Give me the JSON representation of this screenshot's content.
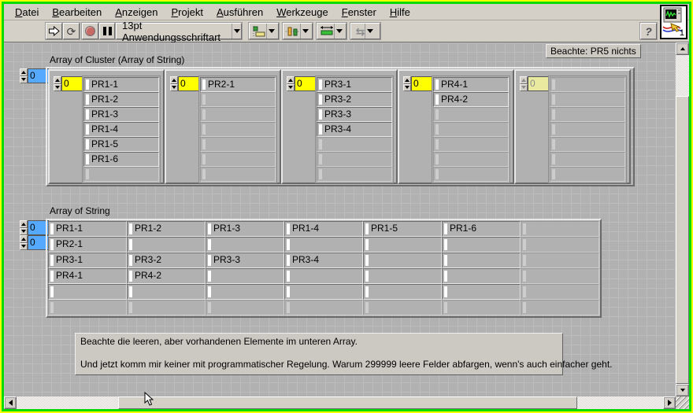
{
  "window": {
    "panel_badge": "1"
  },
  "menu": {
    "items": [
      "Datei",
      "Bearbeiten",
      "Anzeigen",
      "Projekt",
      "Ausführen",
      "Werkzeuge",
      "Fenster",
      "Hilfe"
    ]
  },
  "toolbar": {
    "font_selector": "13pt Anwendungsschriftart",
    "help_label": "?"
  },
  "panel": {
    "note": "Beachte: PR5 nichts",
    "cluster_array": {
      "label": "Array of Cluster (Array of String)",
      "index": "0",
      "visible_rows": 7,
      "clusters": [
        {
          "index": "0",
          "dimmed": false,
          "items": [
            "PR1-1",
            "PR1-2",
            "PR1-3",
            "PR1-4",
            "PR1-5",
            "PR1-6"
          ]
        },
        {
          "index": "0",
          "dimmed": false,
          "items": [
            "PR2-1"
          ]
        },
        {
          "index": "0",
          "dimmed": false,
          "items": [
            "PR3-1",
            "PR3-2",
            "PR3-3",
            "PR3-4"
          ]
        },
        {
          "index": "0",
          "dimmed": false,
          "items": [
            "PR4-1",
            "PR4-2"
          ]
        },
        {
          "index": "0",
          "dimmed": true,
          "items": []
        }
      ]
    },
    "string_array": {
      "label": "Array of String",
      "row_index": "0",
      "col_index": "0",
      "cells": [
        [
          "PR1-1",
          "PR1-2",
          "PR1-3",
          "PR1-4",
          "PR1-5",
          "PR1-6",
          null
        ],
        [
          "PR2-1",
          "",
          "",
          "",
          "",
          "",
          null
        ],
        [
          "PR3-1",
          "PR3-2",
          "PR3-3",
          "PR3-4",
          "",
          "",
          null
        ],
        [
          "PR4-1",
          "PR4-2",
          "",
          "",
          "",
          "",
          null
        ],
        [
          "",
          "",
          "",
          "",
          "",
          "",
          null
        ],
        [
          null,
          null,
          null,
          null,
          null,
          null,
          null
        ]
      ]
    },
    "comment": {
      "line1": "Beachte die leeren, aber vorhandenen Elemente im unteren Array.",
      "line2": "Und jetzt komm mir keiner mit programmatischer Regelung. Warum 299999 leere Felder abfargen, wenn's auch einfacher geht."
    }
  },
  "colors": {
    "index_blue": "#55aaff",
    "index_yellow": "#ffff00",
    "index_yellow_dimmed": "#e9e9a0",
    "panel_gray": "#b1b1b1",
    "chrome_gray": "#d4d0c8",
    "abort_red": "#c76a66",
    "border_outer_yellow": "#ffff00",
    "border_inner_green": "#00dc00"
  }
}
